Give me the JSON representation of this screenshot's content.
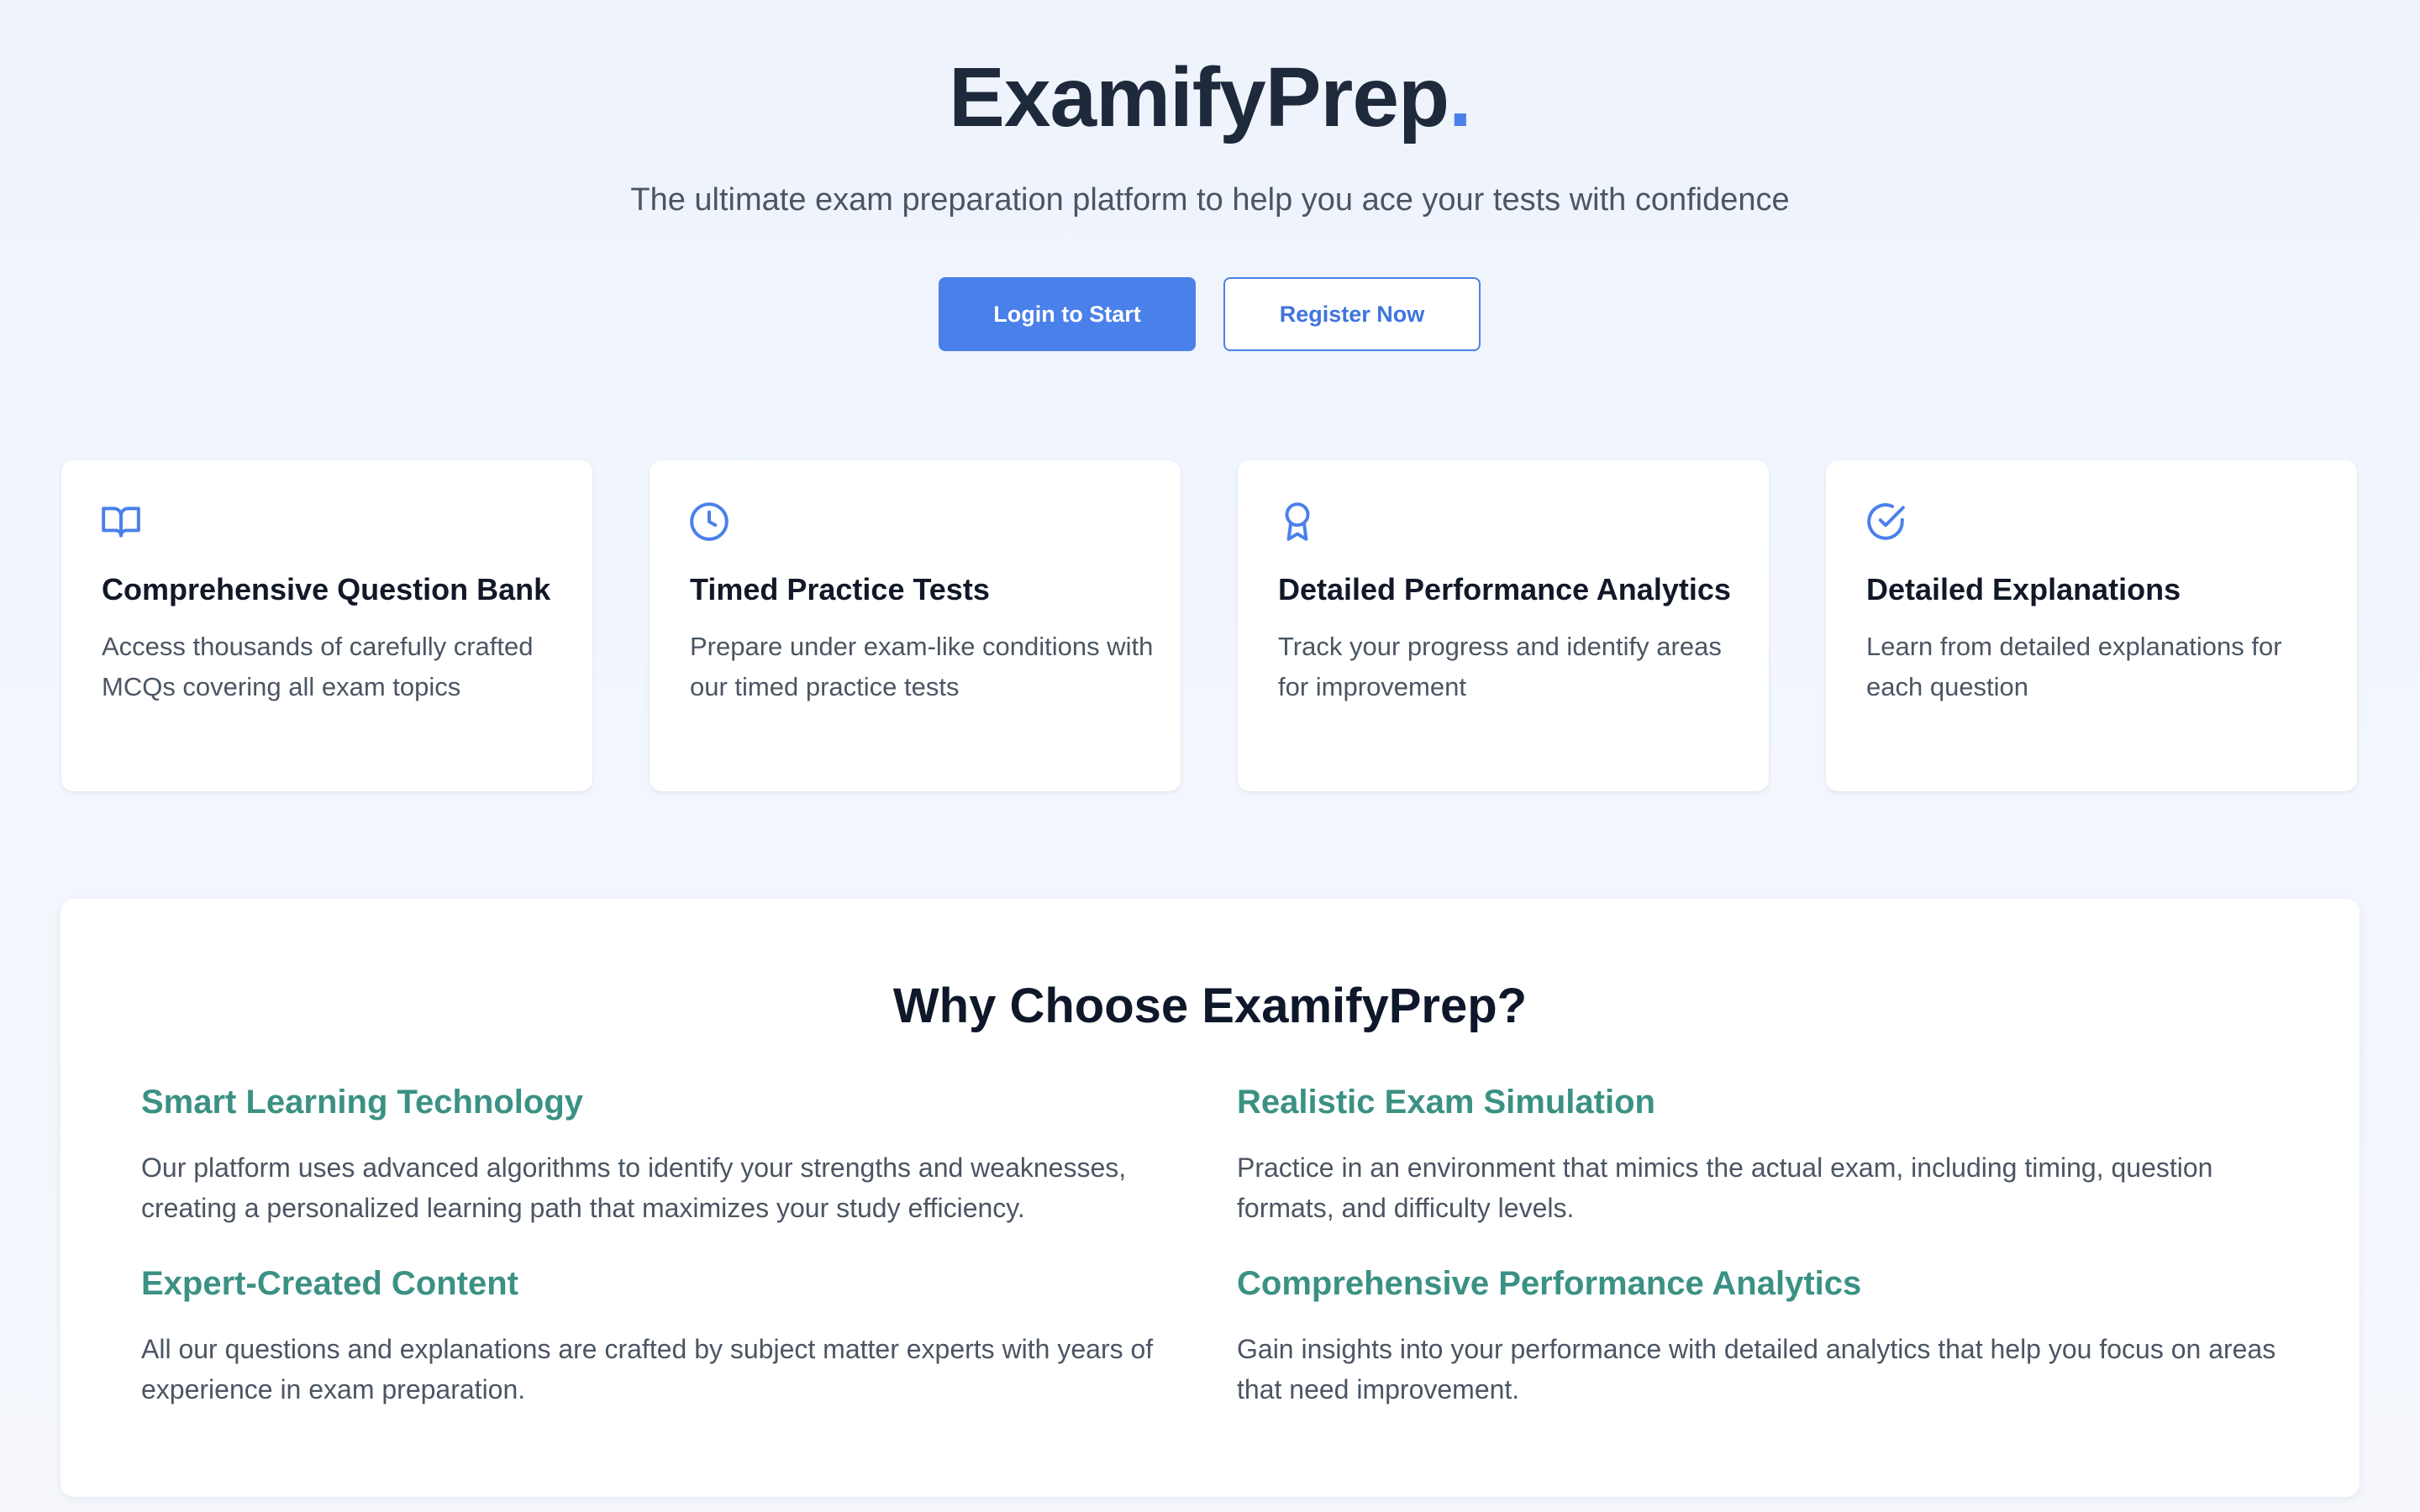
{
  "brand": {
    "name": "ExamifyPrep",
    "dot": "."
  },
  "tagline": "The ultimate exam preparation platform to help you ace your tests with confidence",
  "buttons": {
    "login": "Login to Start",
    "register": "Register Now"
  },
  "features": [
    {
      "icon": "open-book-icon",
      "title": "Comprehensive Question Bank",
      "desc": "Access thousands of carefully crafted MCQs covering all exam topics"
    },
    {
      "icon": "clock-icon",
      "title": "Timed Practice Tests",
      "desc": "Prepare under exam-like conditions with our timed practice tests"
    },
    {
      "icon": "award-ribbon-icon",
      "title": "Detailed Performance Analytics",
      "desc": "Track your progress and identify areas for improvement"
    },
    {
      "icon": "check-circle-icon",
      "title": "Detailed Explanations",
      "desc": "Learn from detailed explanations for each question"
    }
  ],
  "why": {
    "title": "Why Choose ExamifyPrep?",
    "reasons": [
      {
        "title": "Smart Learning Technology",
        "desc": "Our platform uses advanced algorithms to identify your strengths and weaknesses, creating a personalized learning path that maximizes your study efficiency."
      },
      {
        "title": "Realistic Exam Simulation",
        "desc": "Practice in an environment that mimics the actual exam, including timing, question formats, and difficulty levels."
      },
      {
        "title": "Expert-Created Content",
        "desc": "All our questions and explanations are crafted by subject matter experts with years of experience in exam preparation."
      },
      {
        "title": "Comprehensive Performance Analytics",
        "desc": "Gain insights into your performance with detailed analytics that help you focus on areas that need improvement."
      }
    ]
  },
  "colors": {
    "accent": "#4a80ea",
    "heading": "#1e293b",
    "reason_title": "#3b9183",
    "body_text": "#4b5563"
  }
}
